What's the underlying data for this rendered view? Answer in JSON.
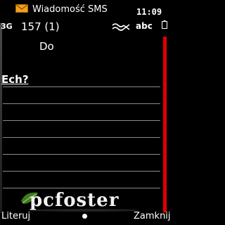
{
  "status": {
    "title": "Wiadomość SMS",
    "clock": "11:09",
    "network": "3G",
    "envelope_icon": "envelope-icon",
    "battery_icon": "battery-icon"
  },
  "compose": {
    "char_counter": "157 (1)",
    "input_mode": "abc",
    "input_mode_icon": "link-icon",
    "to_label": "Do",
    "message_text": "Ech?"
  },
  "softkeys": {
    "left": "Literuj",
    "right": "Zamknij"
  },
  "watermark": {
    "text": "pcfoster",
    "icon": "leaf-logo-icon"
  },
  "colors": {
    "background": "#000000",
    "text": "#ffffff",
    "accent": "#e00000",
    "envelope": "#f0a020",
    "rule_lines": "#8a8a8a"
  }
}
